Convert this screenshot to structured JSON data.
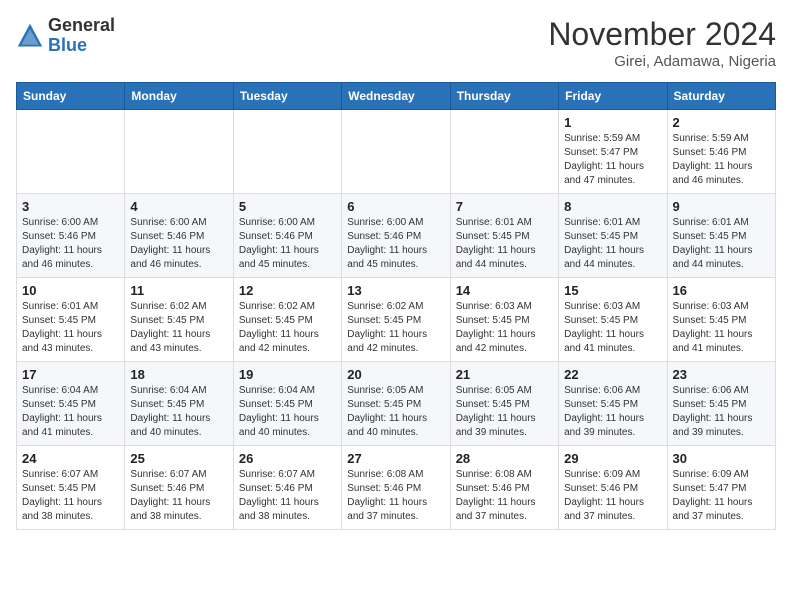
{
  "logo": {
    "general": "General",
    "blue": "Blue"
  },
  "header": {
    "month": "November 2024",
    "location": "Girei, Adamawa, Nigeria"
  },
  "weekdays": [
    "Sunday",
    "Monday",
    "Tuesday",
    "Wednesday",
    "Thursday",
    "Friday",
    "Saturday"
  ],
  "weeks": [
    [
      {
        "day": "",
        "info": ""
      },
      {
        "day": "",
        "info": ""
      },
      {
        "day": "",
        "info": ""
      },
      {
        "day": "",
        "info": ""
      },
      {
        "day": "",
        "info": ""
      },
      {
        "day": "1",
        "info": "Sunrise: 5:59 AM\nSunset: 5:47 PM\nDaylight: 11 hours\nand 47 minutes."
      },
      {
        "day": "2",
        "info": "Sunrise: 5:59 AM\nSunset: 5:46 PM\nDaylight: 11 hours\nand 46 minutes."
      }
    ],
    [
      {
        "day": "3",
        "info": "Sunrise: 6:00 AM\nSunset: 5:46 PM\nDaylight: 11 hours\nand 46 minutes."
      },
      {
        "day": "4",
        "info": "Sunrise: 6:00 AM\nSunset: 5:46 PM\nDaylight: 11 hours\nand 46 minutes."
      },
      {
        "day": "5",
        "info": "Sunrise: 6:00 AM\nSunset: 5:46 PM\nDaylight: 11 hours\nand 45 minutes."
      },
      {
        "day": "6",
        "info": "Sunrise: 6:00 AM\nSunset: 5:46 PM\nDaylight: 11 hours\nand 45 minutes."
      },
      {
        "day": "7",
        "info": "Sunrise: 6:01 AM\nSunset: 5:45 PM\nDaylight: 11 hours\nand 44 minutes."
      },
      {
        "day": "8",
        "info": "Sunrise: 6:01 AM\nSunset: 5:45 PM\nDaylight: 11 hours\nand 44 minutes."
      },
      {
        "day": "9",
        "info": "Sunrise: 6:01 AM\nSunset: 5:45 PM\nDaylight: 11 hours\nand 44 minutes."
      }
    ],
    [
      {
        "day": "10",
        "info": "Sunrise: 6:01 AM\nSunset: 5:45 PM\nDaylight: 11 hours\nand 43 minutes."
      },
      {
        "day": "11",
        "info": "Sunrise: 6:02 AM\nSunset: 5:45 PM\nDaylight: 11 hours\nand 43 minutes."
      },
      {
        "day": "12",
        "info": "Sunrise: 6:02 AM\nSunset: 5:45 PM\nDaylight: 11 hours\nand 42 minutes."
      },
      {
        "day": "13",
        "info": "Sunrise: 6:02 AM\nSunset: 5:45 PM\nDaylight: 11 hours\nand 42 minutes."
      },
      {
        "day": "14",
        "info": "Sunrise: 6:03 AM\nSunset: 5:45 PM\nDaylight: 11 hours\nand 42 minutes."
      },
      {
        "day": "15",
        "info": "Sunrise: 6:03 AM\nSunset: 5:45 PM\nDaylight: 11 hours\nand 41 minutes."
      },
      {
        "day": "16",
        "info": "Sunrise: 6:03 AM\nSunset: 5:45 PM\nDaylight: 11 hours\nand 41 minutes."
      }
    ],
    [
      {
        "day": "17",
        "info": "Sunrise: 6:04 AM\nSunset: 5:45 PM\nDaylight: 11 hours\nand 41 minutes."
      },
      {
        "day": "18",
        "info": "Sunrise: 6:04 AM\nSunset: 5:45 PM\nDaylight: 11 hours\nand 40 minutes."
      },
      {
        "day": "19",
        "info": "Sunrise: 6:04 AM\nSunset: 5:45 PM\nDaylight: 11 hours\nand 40 minutes."
      },
      {
        "day": "20",
        "info": "Sunrise: 6:05 AM\nSunset: 5:45 PM\nDaylight: 11 hours\nand 40 minutes."
      },
      {
        "day": "21",
        "info": "Sunrise: 6:05 AM\nSunset: 5:45 PM\nDaylight: 11 hours\nand 39 minutes."
      },
      {
        "day": "22",
        "info": "Sunrise: 6:06 AM\nSunset: 5:45 PM\nDaylight: 11 hours\nand 39 minutes."
      },
      {
        "day": "23",
        "info": "Sunrise: 6:06 AM\nSunset: 5:45 PM\nDaylight: 11 hours\nand 39 minutes."
      }
    ],
    [
      {
        "day": "24",
        "info": "Sunrise: 6:07 AM\nSunset: 5:45 PM\nDaylight: 11 hours\nand 38 minutes."
      },
      {
        "day": "25",
        "info": "Sunrise: 6:07 AM\nSunset: 5:46 PM\nDaylight: 11 hours\nand 38 minutes."
      },
      {
        "day": "26",
        "info": "Sunrise: 6:07 AM\nSunset: 5:46 PM\nDaylight: 11 hours\nand 38 minutes."
      },
      {
        "day": "27",
        "info": "Sunrise: 6:08 AM\nSunset: 5:46 PM\nDaylight: 11 hours\nand 37 minutes."
      },
      {
        "day": "28",
        "info": "Sunrise: 6:08 AM\nSunset: 5:46 PM\nDaylight: 11 hours\nand 37 minutes."
      },
      {
        "day": "29",
        "info": "Sunrise: 6:09 AM\nSunset: 5:46 PM\nDaylight: 11 hours\nand 37 minutes."
      },
      {
        "day": "30",
        "info": "Sunrise: 6:09 AM\nSunset: 5:47 PM\nDaylight: 11 hours\nand 37 minutes."
      }
    ]
  ]
}
